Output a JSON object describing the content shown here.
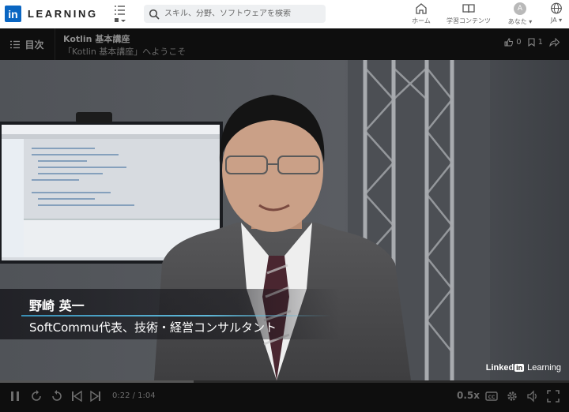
{
  "nav": {
    "logo_text": "LEARNING",
    "logo_mark": "in",
    "search_placeholder": "スキル、分野、ソフトウェアを検索",
    "items": [
      {
        "label": "ホーム",
        "icon": "home-icon"
      },
      {
        "label": "学習コンテンツ",
        "icon": "book-icon"
      },
      {
        "label": "あなた",
        "icon": "avatar"
      },
      {
        "label": "JA",
        "icon": "globe-icon"
      }
    ],
    "avatar_initial": "A"
  },
  "course": {
    "toc_label": "目次",
    "title": "Kotlin 基本講座",
    "video_title": "「Kotlin 基本講座」へようこそ",
    "likes": "0",
    "saves": "1"
  },
  "video": {
    "presenter_name": "野崎 英一",
    "presenter_title": "SoftCommu代表、技術・経営コンサルタント",
    "watermark_brand": "Linked",
    "watermark_in": "in",
    "watermark_product": "Learning"
  },
  "player": {
    "current_time": "0:22",
    "duration": "1:04",
    "timecode": "0:22 / 1:04",
    "progress": 0.34,
    "speed": "0.5x"
  },
  "colors": {
    "brand": "#0a66c2",
    "accent_line": "#5fb8d8",
    "bar_bg": "#0e0e0e"
  }
}
